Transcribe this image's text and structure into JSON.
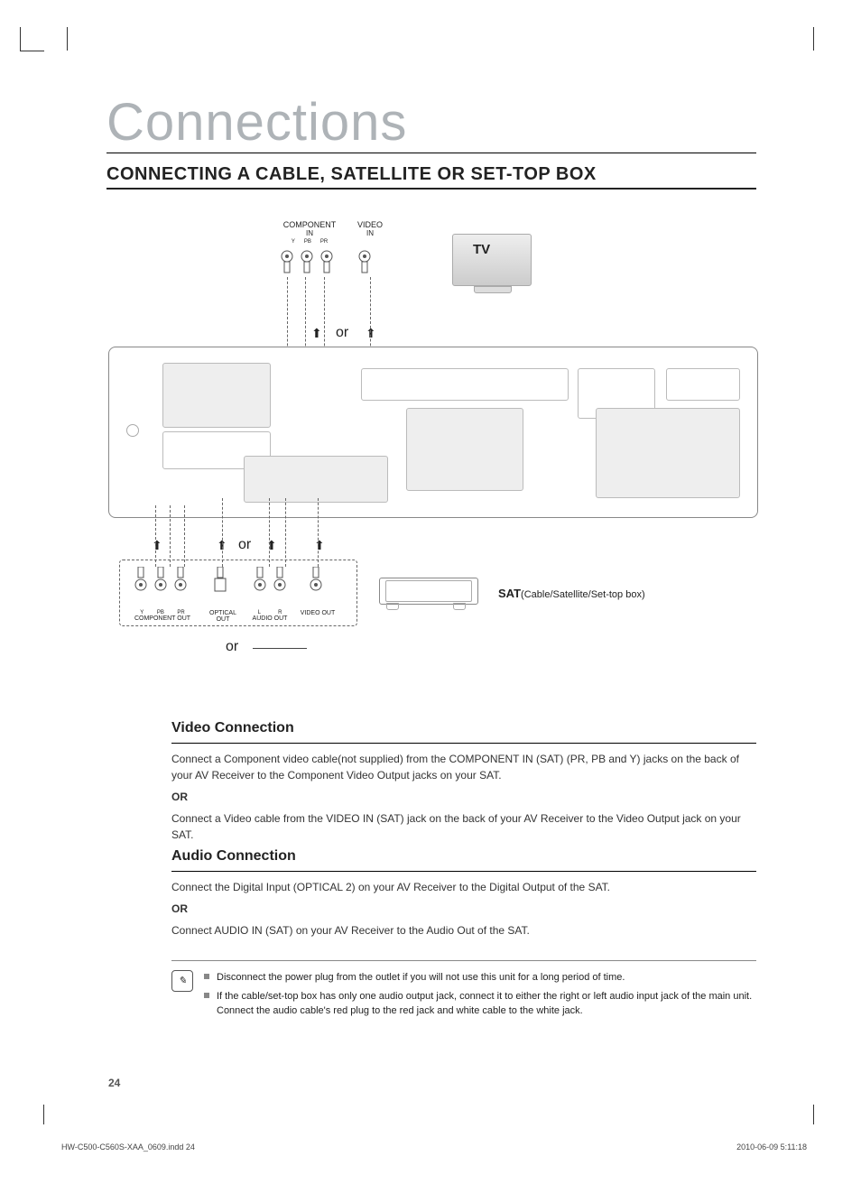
{
  "title": "Connections",
  "subtitle": "CONNECTING A CABLE, SATELLITE OR SET-TOP BOX",
  "diagram": {
    "component_in": "COMPONENT",
    "component_in2": "IN",
    "video_in": "VIDEO",
    "video_in2": "IN",
    "ypbpr_y": "Y",
    "ypbpr_pb": "PB",
    "ypbpr_pr": "PR",
    "tv": "TV",
    "or1": "or",
    "or2": "or",
    "or3": "or",
    "component_out": "COMPONENT OUT",
    "optical_out": "OPTICAL OUT",
    "audio_out": "AUDIO OUT",
    "audio_l": "L",
    "audio_r": "R",
    "video_out": "VIDEO OUT",
    "sat_label": "SAT",
    "sat_desc": "(Cable/Satellite/Set-top box)"
  },
  "video_section": {
    "heading": "Video Connection",
    "p1": "Connect a Component video cable(not supplied) from the COMPONENT IN (SAT) (PR, PB and Y) jacks on the back of your AV Receiver to the Component Video Output jacks on your SAT.",
    "or": "OR",
    "p2": "Connect a Video cable from the VIDEO IN (SAT) jack on the back of your AV Receiver to the Video Output jack on your SAT."
  },
  "audio_section": {
    "heading": "Audio Connection",
    "p1": "Connect the Digital Input (OPTICAL 2) on your AV Receiver to the Digital Output of the SAT.",
    "or": "OR",
    "p2": "Connect AUDIO IN (SAT) on your AV Receiver to the Audio Out of the SAT."
  },
  "notes": {
    "b1": "Disconnect the power plug from the outlet if you will not use this unit for a long period of time.",
    "b2": "If the cable/set-top box has only one audio output jack, connect it to either the right or left audio input jack of the main unit. Connect the audio cable's red plug to the red jack and white cable to the white jack."
  },
  "page_number": "24",
  "footer_file": "HW-C500-C560S-XAA_0609.indd   24",
  "footer_date": "2010-06-09   5:11:18"
}
